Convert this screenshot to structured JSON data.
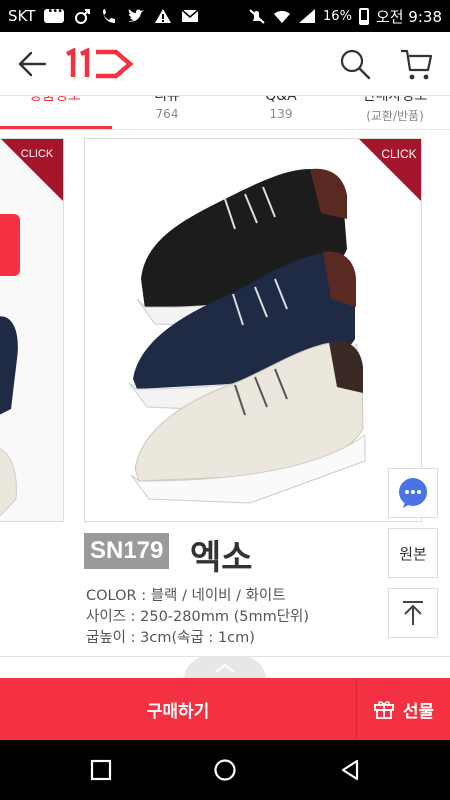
{
  "status_bar": {
    "carrier": "SKT",
    "battery": "16%",
    "time": "오전 9:38"
  },
  "header": {
    "logo_text": "11"
  },
  "tabs": [
    {
      "label": "상품정보",
      "count": ""
    },
    {
      "label": "리뷰",
      "count": "764"
    },
    {
      "label": "Q&A",
      "count": "139"
    },
    {
      "label": "판매자정보",
      "count": "(교환/반품)"
    }
  ],
  "product": {
    "click_label": "CLICK",
    "code": "SN179",
    "name": "엑소",
    "specs": [
      "COLOR : 블랙 / 네이비 / 화이트",
      "사이즈 : 250-280mm (5mm단위)",
      "굽높이 : 3cm(속굽 : 1cm)"
    ],
    "shoe_colors": [
      "#1c1c1c",
      "#1f2b44",
      "#ece7dc"
    ]
  },
  "side_buttons": {
    "original_label": "원본"
  },
  "bottom_bar": {
    "buy_label": "구매하기",
    "gift_label": "선물"
  },
  "colors": {
    "brand": "#f43142"
  }
}
